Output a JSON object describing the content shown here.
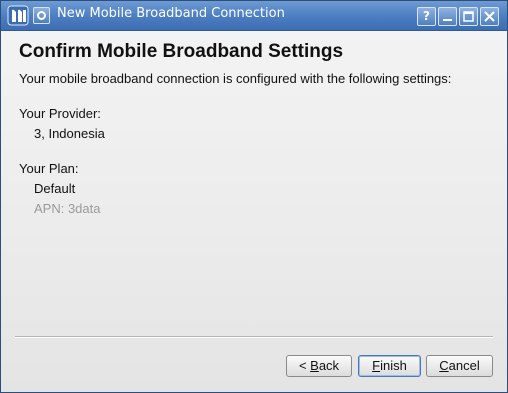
{
  "window": {
    "title": "New Mobile Broadband Connection",
    "controls": {
      "help": "?",
      "minimize": "—",
      "maximize": "□",
      "close": "✕"
    }
  },
  "page": {
    "heading": "Confirm Mobile Broadband Settings",
    "subtitle": "Your mobile broadband connection is configured with the following settings:",
    "provider_label": "Your Provider:",
    "provider_value": "3, Indonesia",
    "plan_label": "Your Plan:",
    "plan_value": "Default",
    "apn_text": "APN: 3data"
  },
  "buttons": {
    "back_prefix": "< ",
    "back_mnemonic": "B",
    "back_rest": "ack",
    "finish_mnemonic": "F",
    "finish_rest": "inish",
    "cancel_mnemonic": "C",
    "cancel_rest": "ancel"
  },
  "colors": {
    "titlebar": "#4d7fc2",
    "dialog_bg": "#efefef",
    "dim_text": "#9a9a9a"
  }
}
